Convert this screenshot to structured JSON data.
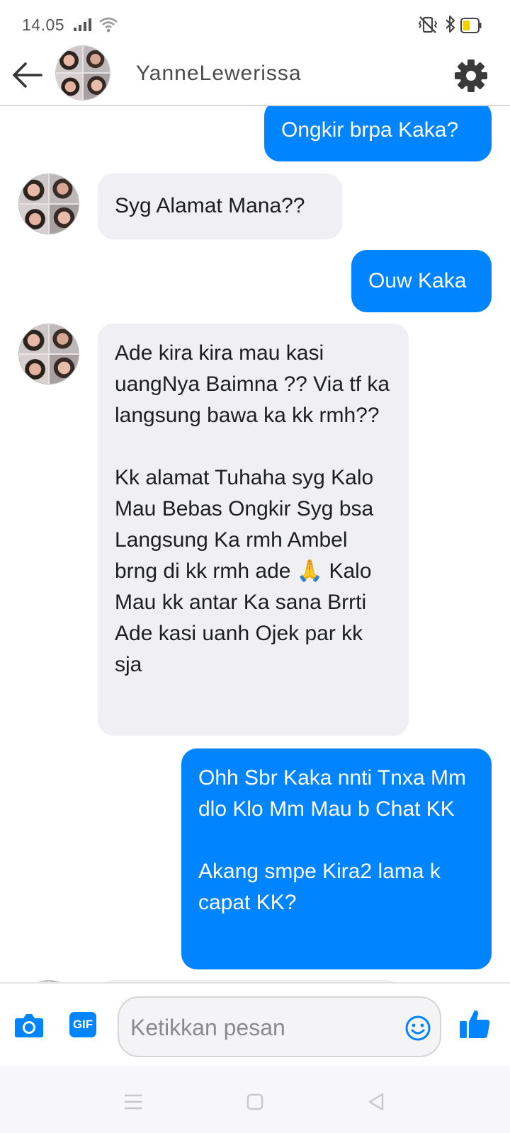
{
  "status_bar": {
    "time": "14.05"
  },
  "header": {
    "contact_name": "YanneLewerissa"
  },
  "messages": [
    {
      "direction": "outgoing",
      "text": "Ongkir brpa Kaka?"
    },
    {
      "direction": "incoming",
      "text": "Syg Alamat Mana??"
    },
    {
      "direction": "outgoing",
      "text": "Ouw Kaka"
    },
    {
      "direction": "incoming",
      "text": "Ade kira kira mau kasi uangNya Baimna ?? Via tf ka langsung bawa ka kk rmh??\n\nKk alamat Tuhaha syg Kalo Mau Bebas Ongkir Syg bsa Langsung Ka rmh Ambel brng di kk rmh ade 🙏 Kalo Mau kk antar Ka sana Brrti Ade kasi uanh Ojek par kk sja"
    },
    {
      "direction": "outgoing",
      "text": "Ohh Sbr Kaka nnti Tnxa Mm dlo Klo Mm Mau b Chat KK\n\nAkang smpe Kira2 lama k capat KK?"
    }
  ],
  "composer": {
    "placeholder": "Ketikkan pesan",
    "gif_label": "GIF"
  },
  "icons": {
    "back": "back-arrow-icon",
    "settings": "gear-icon",
    "camera": "camera-icon",
    "gif": "gif-icon",
    "emoji": "emoji-icon",
    "like": "thumbs-up-icon"
  },
  "colors": {
    "outgoing_bubble": "#0084ff",
    "incoming_bubble": "#f0f0f4",
    "accent": "#0084ff"
  }
}
